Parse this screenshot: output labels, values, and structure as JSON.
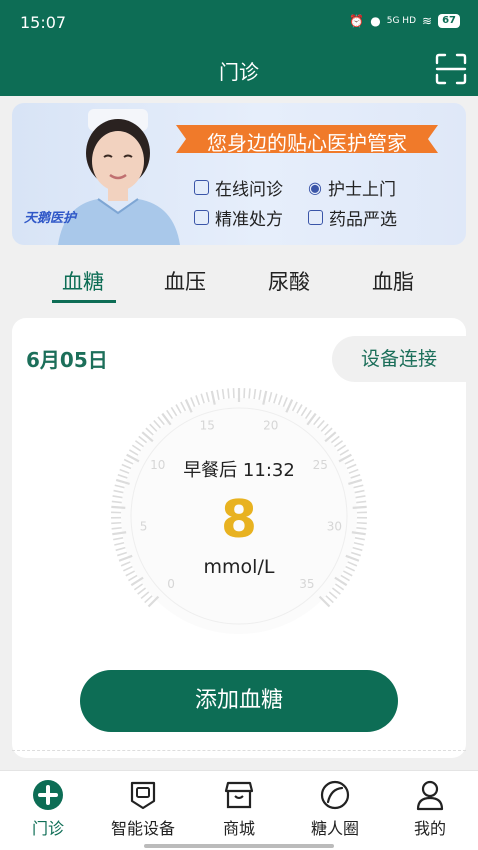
{
  "status": {
    "time": "15:07",
    "network": "5G HD",
    "battery": "67"
  },
  "header": {
    "title": "门诊"
  },
  "banner": {
    "brand": "天鹅医护",
    "slogan": "您身边的贴心医护管家",
    "features": [
      "在线问诊",
      "护士上门",
      "精准处方",
      "药品严选"
    ]
  },
  "tabs": [
    "血糖",
    "血压",
    "尿酸",
    "血脂"
  ],
  "card": {
    "date": "6月05日",
    "connect_label": "设备连接",
    "meal_time": "早餐后 11:32",
    "value": "8",
    "unit": "mmol/L",
    "add_button": "添加血糖",
    "gauge": {
      "min": 0,
      "max": 35,
      "ticks": [
        "0",
        "5",
        "10",
        "15",
        "20",
        "25",
        "30",
        "35"
      ],
      "current": 8
    }
  },
  "bottom_nav": [
    {
      "label": "门诊",
      "icon": "clinic-plus-icon",
      "active": true
    },
    {
      "label": "智能设备",
      "icon": "device-icon",
      "active": false
    },
    {
      "label": "商城",
      "icon": "store-icon",
      "active": false
    },
    {
      "label": "糖人圈",
      "icon": "community-icon",
      "active": false
    },
    {
      "label": "我的",
      "icon": "profile-icon",
      "active": false
    }
  ],
  "colors": {
    "primary": "#0d6d55",
    "accent": "#e8b220",
    "ribbon": "#f07a2a"
  }
}
